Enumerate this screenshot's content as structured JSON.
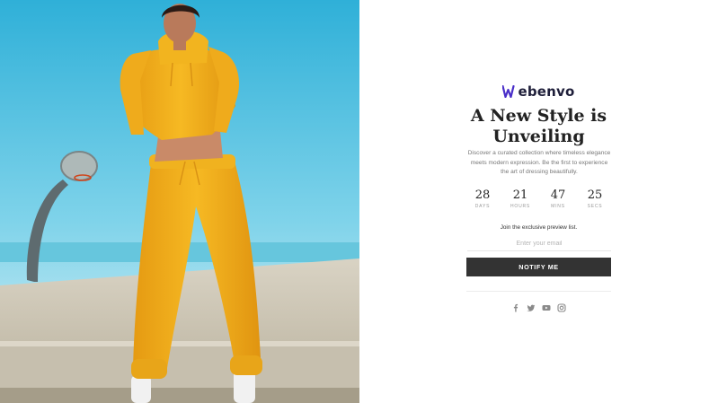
{
  "brand": {
    "name": "ebenvo",
    "mark_color": "#4a2fc9",
    "text_color": "#1f1f3a"
  },
  "hero": {
    "icon": "hero-photo-image",
    "alt": "Model in yellow tracksuit on a basketball court"
  },
  "headline": {
    "line1": "A New Style is",
    "line2": "Unveiling"
  },
  "description": {
    "line1": "Discover a curated collection where timeless elegance",
    "line2": "meets modern expression. Be the first to experience",
    "line3": "the art of dressing beautifully."
  },
  "countdown": [
    {
      "value": "28",
      "label": "DAYS"
    },
    {
      "value": "21",
      "label": "HOURS"
    },
    {
      "value": "47",
      "label": "MINS"
    },
    {
      "value": "25",
      "label": "SECS"
    }
  ],
  "signup": {
    "prompt": "Join the exclusive preview list.",
    "email_placeholder": "Enter your email",
    "email_value": "",
    "button_label": "NOTIFY ME",
    "button_color": "#333333"
  },
  "social_icons": [
    "facebook-icon",
    "twitter-icon",
    "youtube-icon",
    "instagram-icon"
  ]
}
